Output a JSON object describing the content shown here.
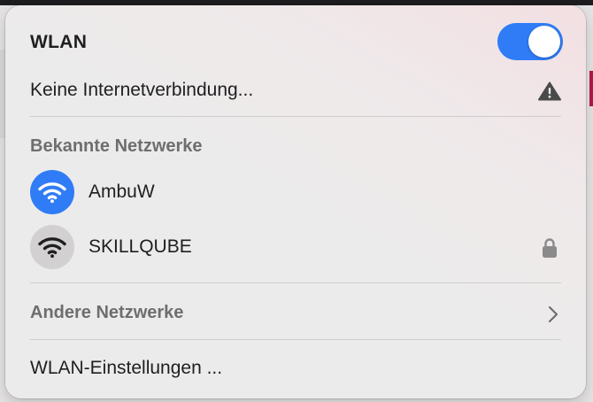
{
  "header": {
    "title": "WLAN",
    "wifi_enabled": true,
    "toggle_color": "#2f7cf6"
  },
  "status": {
    "text": "Keine Internetverbindung...",
    "icon": "warning-triangle-icon"
  },
  "known_networks": {
    "heading": "Bekannte Netzwerke",
    "items": [
      {
        "name": "AmbuW",
        "connected": true,
        "icon": "wifi-icon",
        "secured": false
      },
      {
        "name": "SKILLQUBE",
        "connected": false,
        "icon": "wifi-icon",
        "secured": true
      }
    ]
  },
  "other_networks": {
    "label": "Andere Netzwerke",
    "icon": "chevron-right-icon"
  },
  "settings": {
    "label": "WLAN-Einstellungen ..."
  }
}
